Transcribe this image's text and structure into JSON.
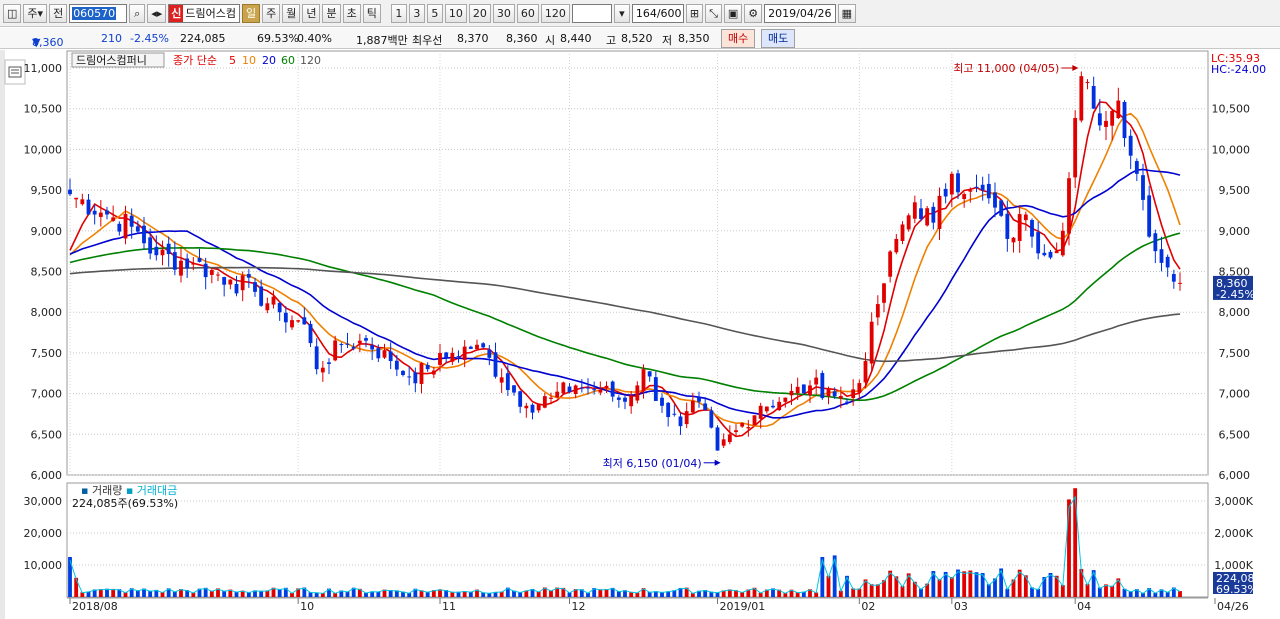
{
  "toolbar": {
    "code": "060570",
    "name": "드림어스컴",
    "shin": "신",
    "jeon": "전",
    "ju": "주",
    "periods": [
      "일",
      "주",
      "월",
      "년",
      "분",
      "초",
      "틱"
    ],
    "nums": [
      "1",
      "3",
      "5",
      "10",
      "20",
      "30",
      "60",
      "120"
    ],
    "count": "164/600",
    "date": "2019/04/26"
  },
  "quote": {
    "price": "8,360",
    "arrow": "▼",
    "change": "210",
    "pct": "-2.45%",
    "volume": "224,085",
    "vol_ratio": "69.53%",
    "turnover": "0.40%",
    "amount": "1,887백만",
    "prefer_label": "최우선",
    "ask": "8,370",
    "bid": "8,360",
    "open_label": "시",
    "open": "8,440",
    "high_label": "고",
    "high": "8,520",
    "low_label": "저",
    "low": "8,350",
    "buy": "매수",
    "sell": "매도"
  },
  "chart_data": {
    "type": "candlestick",
    "legend": {
      "name": "드림어스컴퍼니",
      "ma_label": "종가 단순",
      "ma": [
        {
          "name": "5",
          "color": "#e00000"
        },
        {
          "name": "10",
          "color": "#f08000"
        },
        {
          "name": "20",
          "color": "#0000d0"
        },
        {
          "name": "60",
          "color": "#008000"
        },
        {
          "name": "120",
          "color": "#555555"
        }
      ]
    },
    "price_axis": {
      "ylim": [
        6000,
        11000
      ],
      "ticks": [
        "6,000",
        "6,500",
        "7,000",
        "7,500",
        "8,000",
        "8,500",
        "9,000",
        "9,500",
        "10,000",
        "10,500",
        "11,000"
      ],
      "tick_values": [
        6000,
        6500,
        7000,
        7500,
        8000,
        8500,
        9000,
        9500,
        10000,
        10500,
        11000
      ]
    },
    "x_labels": [
      "2018/08",
      "10",
      "11",
      "12",
      "2019/01",
      "02",
      "03",
      "04",
      "04/26"
    ],
    "x_label_days": [
      0,
      37,
      60,
      81,
      105,
      128,
      143,
      163,
      180
    ],
    "n_days": 180,
    "lc": "LC:35.93",
    "hc": "HC:-24.00",
    "last_price": "8,360",
    "last_pct": "-2.45%",
    "last_value": 8360,
    "high_ann": {
      "text": "최고 11,000 (04/05)",
      "day": 164,
      "value": 11000
    },
    "low_ann": {
      "text": "최저 6,150 (01/04)",
      "day": 106,
      "value": 6150
    },
    "close_anchors": [
      [
        0,
        9450
      ],
      [
        6,
        9200
      ],
      [
        10,
        9050
      ],
      [
        14,
        8700
      ],
      [
        20,
        8600
      ],
      [
        26,
        8400
      ],
      [
        30,
        8250
      ],
      [
        34,
        8000
      ],
      [
        38,
        7850
      ],
      [
        40,
        7300
      ],
      [
        44,
        7600
      ],
      [
        48,
        7650
      ],
      [
        52,
        7400
      ],
      [
        55,
        7200
      ],
      [
        58,
        7300
      ],
      [
        62,
        7500
      ],
      [
        66,
        7600
      ],
      [
        70,
        7200
      ],
      [
        74,
        6850
      ],
      [
        78,
        6950
      ],
      [
        82,
        7100
      ],
      [
        86,
        7050
      ],
      [
        90,
        6900
      ],
      [
        93,
        7300
      ],
      [
        96,
        6850
      ],
      [
        99,
        6600
      ],
      [
        102,
        6900
      ],
      [
        105,
        6300
      ],
      [
        108,
        6550
      ],
      [
        112,
        6850
      ],
      [
        116,
        6950
      ],
      [
        120,
        7100
      ],
      [
        123,
        7050
      ],
      [
        126,
        6900
      ],
      [
        129,
        7400
      ],
      [
        131,
        8100
      ],
      [
        134,
        8900
      ],
      [
        137,
        9350
      ],
      [
        140,
        9100
      ],
      [
        143,
        9700
      ],
      [
        146,
        9500
      ],
      [
        149,
        9400
      ],
      [
        152,
        8900
      ],
      [
        155,
        9200
      ],
      [
        158,
        8700
      ],
      [
        161,
        9000
      ],
      [
        164,
        10900
      ],
      [
        166,
        10500
      ],
      [
        168,
        10350
      ],
      [
        170,
        10600
      ],
      [
        173,
        9700
      ],
      [
        176,
        8750
      ],
      [
        178,
        8550
      ],
      [
        180,
        8360
      ]
    ],
    "spike_volume_days": [
      [
        122,
        12500
      ],
      [
        124,
        13000
      ],
      [
        162,
        30500
      ],
      [
        163,
        34000
      ]
    ],
    "volume": {
      "label": "거래량",
      "amount_label": "거래대금",
      "current": "224,085주(69.53%)",
      "ylim": [
        0,
        35000
      ],
      "ticks": [
        "10,000",
        "20,000",
        "30,000"
      ],
      "right_ticks": [
        "1,000K",
        "2,000K",
        "3,000K"
      ],
      "last_value": "224,085",
      "last_pct": "69.53%"
    }
  }
}
